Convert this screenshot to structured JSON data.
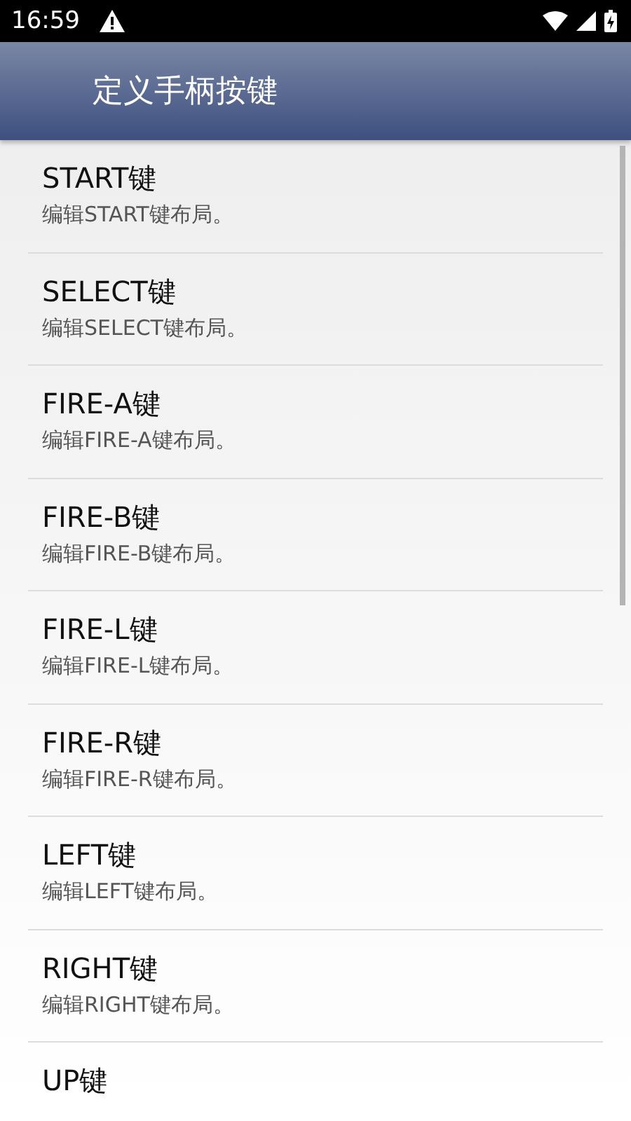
{
  "status_bar": {
    "time": "16:59"
  },
  "app_bar": {
    "title": "定义手柄按键"
  },
  "items": [
    {
      "title": "START键",
      "summary": "编辑START键布局。"
    },
    {
      "title": "SELECT键",
      "summary": "编辑SELECT键布局。"
    },
    {
      "title": "FIRE-A键",
      "summary": "编辑FIRE-A键布局。"
    },
    {
      "title": "FIRE-B键",
      "summary": "编辑FIRE-B键布局。"
    },
    {
      "title": "FIRE-L键",
      "summary": "编辑FIRE-L键布局。"
    },
    {
      "title": "FIRE-R键",
      "summary": "编辑FIRE-R键布局。"
    },
    {
      "title": "LEFT键",
      "summary": "编辑LEFT键布局。"
    },
    {
      "title": "RIGHT键",
      "summary": "编辑RIGHT键布局。"
    },
    {
      "title": "UP键"
    }
  ]
}
